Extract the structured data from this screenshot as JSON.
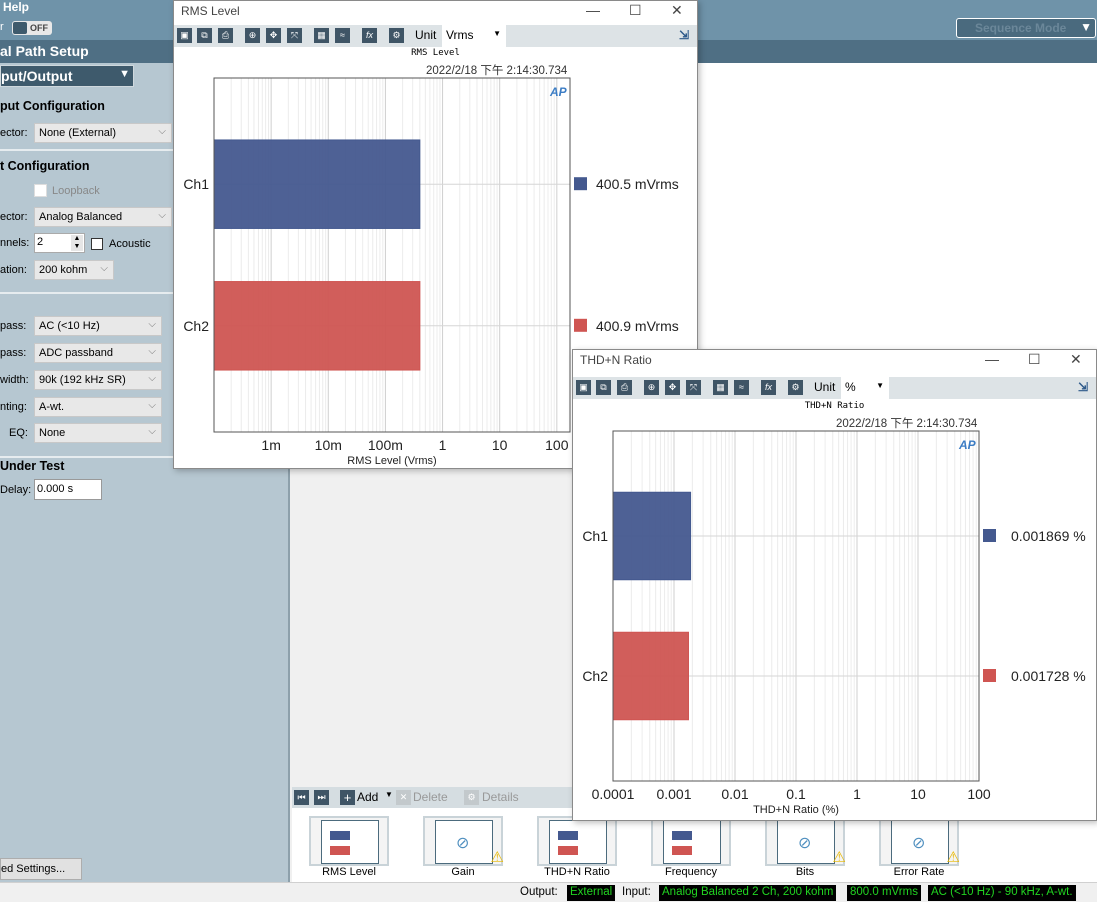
{
  "app": {
    "menu_help": "Help",
    "toggle_label": "OFF",
    "path_title": "al Path Setup",
    "section_select": "put/Output",
    "sequence_mode": "Sequence Mode"
  },
  "left": {
    "output_config": "put Configuration",
    "out_connector_label": "ector:",
    "out_connector": "None (External)",
    "input_config": "t Configuration",
    "loopback": "Loopback",
    "in_connector_label": "ector:",
    "in_connector": "Analog Balanced",
    "channels_label": "nnels:",
    "channels": "2",
    "acoustic": "Acoustic",
    "termination_label": "ation:",
    "termination": "200 kohm",
    "highpass_label": "pass:",
    "highpass": "AC (<10 Hz)",
    "lowpass_label": "pass:",
    "lowpass": "ADC passband",
    "bandwidth_label": "width:",
    "bandwidth": "90k (192 kHz SR)",
    "weighting_label": "nting:",
    "weighting": "A-wt.",
    "eq_label": "EQ:",
    "eq": "None",
    "dut": "Under Test",
    "delay_label": "Delay:",
    "delay": "0.000 s",
    "advanced": "ed Settings..."
  },
  "rms_window": {
    "title": "RMS Level",
    "unit_label": "Unit",
    "unit": "Vrms",
    "timestamp": "2022/2/18 下午 2:14:30.734"
  },
  "thd_window": {
    "title": "THD+N Ratio",
    "unit_label": "Unit",
    "unit": "%",
    "timestamp": "2022/2/18 下午 2:14:30.734"
  },
  "nav": {
    "add": "Add",
    "delete": "Delete",
    "details": "Details"
  },
  "thumbnails": [
    {
      "label": "RMS Level",
      "warning": false
    },
    {
      "label": "Gain",
      "warning": true
    },
    {
      "label": "THD+N Ratio",
      "warning": false
    },
    {
      "label": "Frequency",
      "warning": false
    },
    {
      "label": "Bits",
      "warning": true
    },
    {
      "label": "Error Rate",
      "warning": true
    }
  ],
  "status": {
    "output_label": "Output:",
    "output": "External",
    "input_label": "Input:",
    "input": "Analog Balanced 2 Ch, 200 kohm",
    "level": "800.0 mVrms",
    "filter": "AC (<10 Hz) - 90 kHz, A-wt."
  },
  "chart_data": [
    {
      "type": "bar",
      "orientation": "horizontal",
      "title": "RMS Level",
      "xlabel": "RMS Level (Vrms)",
      "x_scale": "log",
      "xlim": [
        0.0001,
        170
      ],
      "x_ticks": [
        0.001,
        0.01,
        0.1,
        1,
        10,
        100
      ],
      "x_tick_labels": [
        "1m",
        "10m",
        "100m",
        "1",
        "10",
        "100"
      ],
      "categories": [
        "Ch1",
        "Ch2"
      ],
      "values": [
        0.4005,
        0.4009
      ],
      "value_labels": [
        "400.5 mVrms",
        "400.9 mVrms"
      ],
      "colors": [
        "#44598f",
        "#cf5552"
      ],
      "grid": true
    },
    {
      "type": "bar",
      "orientation": "horizontal",
      "title": "THD+N Ratio",
      "xlabel": "THD+N Ratio (%)",
      "x_scale": "log",
      "xlim": [
        0.0001,
        100
      ],
      "x_ticks": [
        0.0001,
        0.001,
        0.01,
        0.1,
        1,
        10,
        100
      ],
      "x_tick_labels": [
        "0.0001",
        "0.001",
        "0.01",
        "0.1",
        "1",
        "10",
        "100"
      ],
      "categories": [
        "Ch1",
        "Ch2"
      ],
      "values": [
        0.001869,
        0.001728
      ],
      "value_labels": [
        "0.001869 %",
        "0.001728 %"
      ],
      "colors": [
        "#44598f",
        "#cf5552"
      ],
      "grid": true
    }
  ]
}
